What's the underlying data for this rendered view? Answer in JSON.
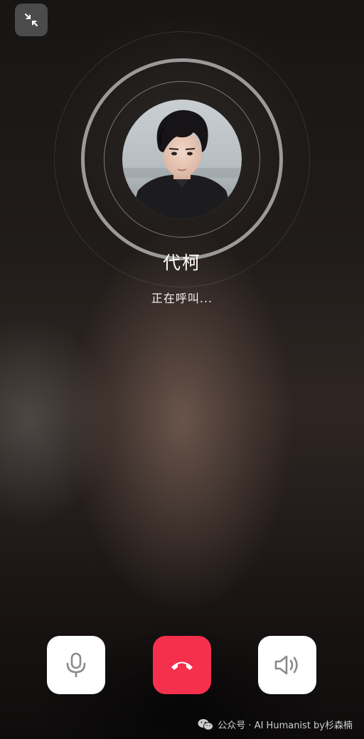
{
  "toolbar": {
    "minimize_icon": "minimize-arrows-icon"
  },
  "caller": {
    "name": "代柯",
    "status": "正在呼叫..."
  },
  "controls": {
    "mic_icon": "microphone-icon",
    "hangup_icon": "phone-hangup-icon",
    "speaker_icon": "speaker-icon",
    "hangup_color": "#f5304d"
  },
  "watermark": {
    "icon": "wechat-icon",
    "text": "公众号 · AI Humanist by杉森楠"
  }
}
